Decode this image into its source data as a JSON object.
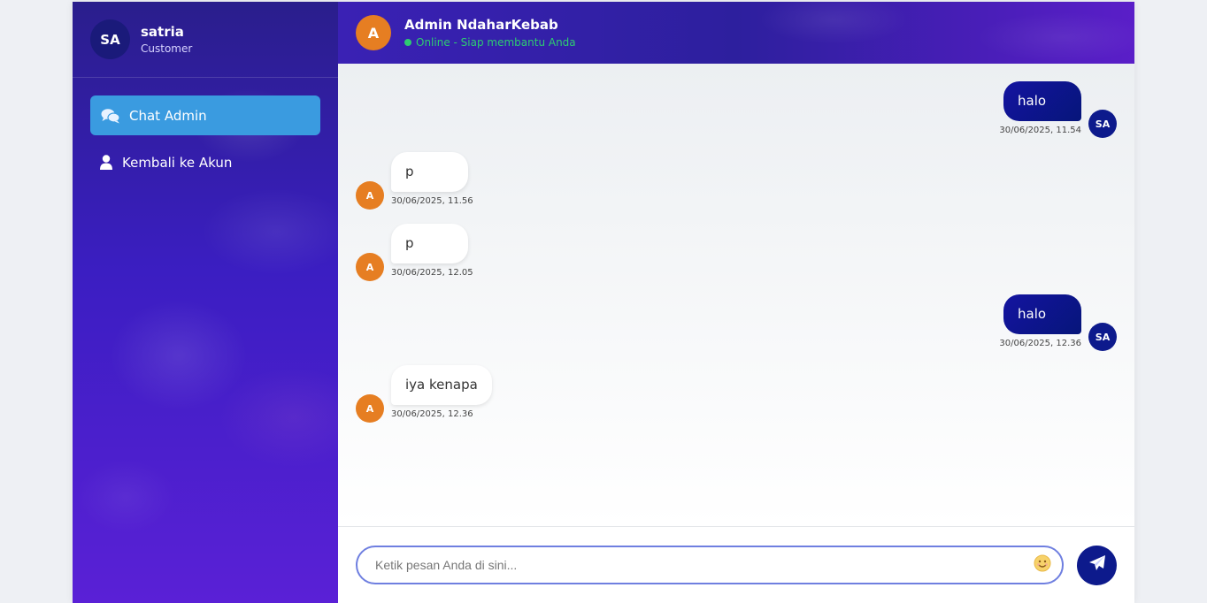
{
  "user": {
    "initials": "SA",
    "name": "satria",
    "role": "Customer"
  },
  "nav": [
    {
      "label": "Chat Admin",
      "icon": "comments-icon",
      "active": true
    },
    {
      "label": "Kembali ke Akun",
      "icon": "user-icon",
      "active": false
    }
  ],
  "chat": {
    "admin_initial": "A",
    "title": "Admin NdaharKebab",
    "status": "Online - Siap membantu Anda",
    "status_color": "#2ecc71"
  },
  "messages": [
    {
      "direction": "out",
      "text": "halo",
      "time": "30/06/2025, 11.54",
      "avatar": "SA"
    },
    {
      "direction": "in",
      "text": "p",
      "time": "30/06/2025, 11.56",
      "avatar": "A"
    },
    {
      "direction": "in",
      "text": "p",
      "time": "30/06/2025, 12.05",
      "avatar": "A"
    },
    {
      "direction": "out",
      "text": "halo",
      "time": "30/06/2025, 12.36",
      "avatar": "SA"
    },
    {
      "direction": "in",
      "text": "iya kenapa",
      "time": "30/06/2025, 12.36",
      "avatar": "A"
    }
  ],
  "composer": {
    "placeholder": "Ketik pesan Anda di sini...",
    "emoji_icon": "smile-icon",
    "send_icon": "send-icon"
  },
  "colors": {
    "accent": "#3a9be0",
    "sent_bubble": "#1414a0",
    "admin_avatar": "#e67e22"
  }
}
